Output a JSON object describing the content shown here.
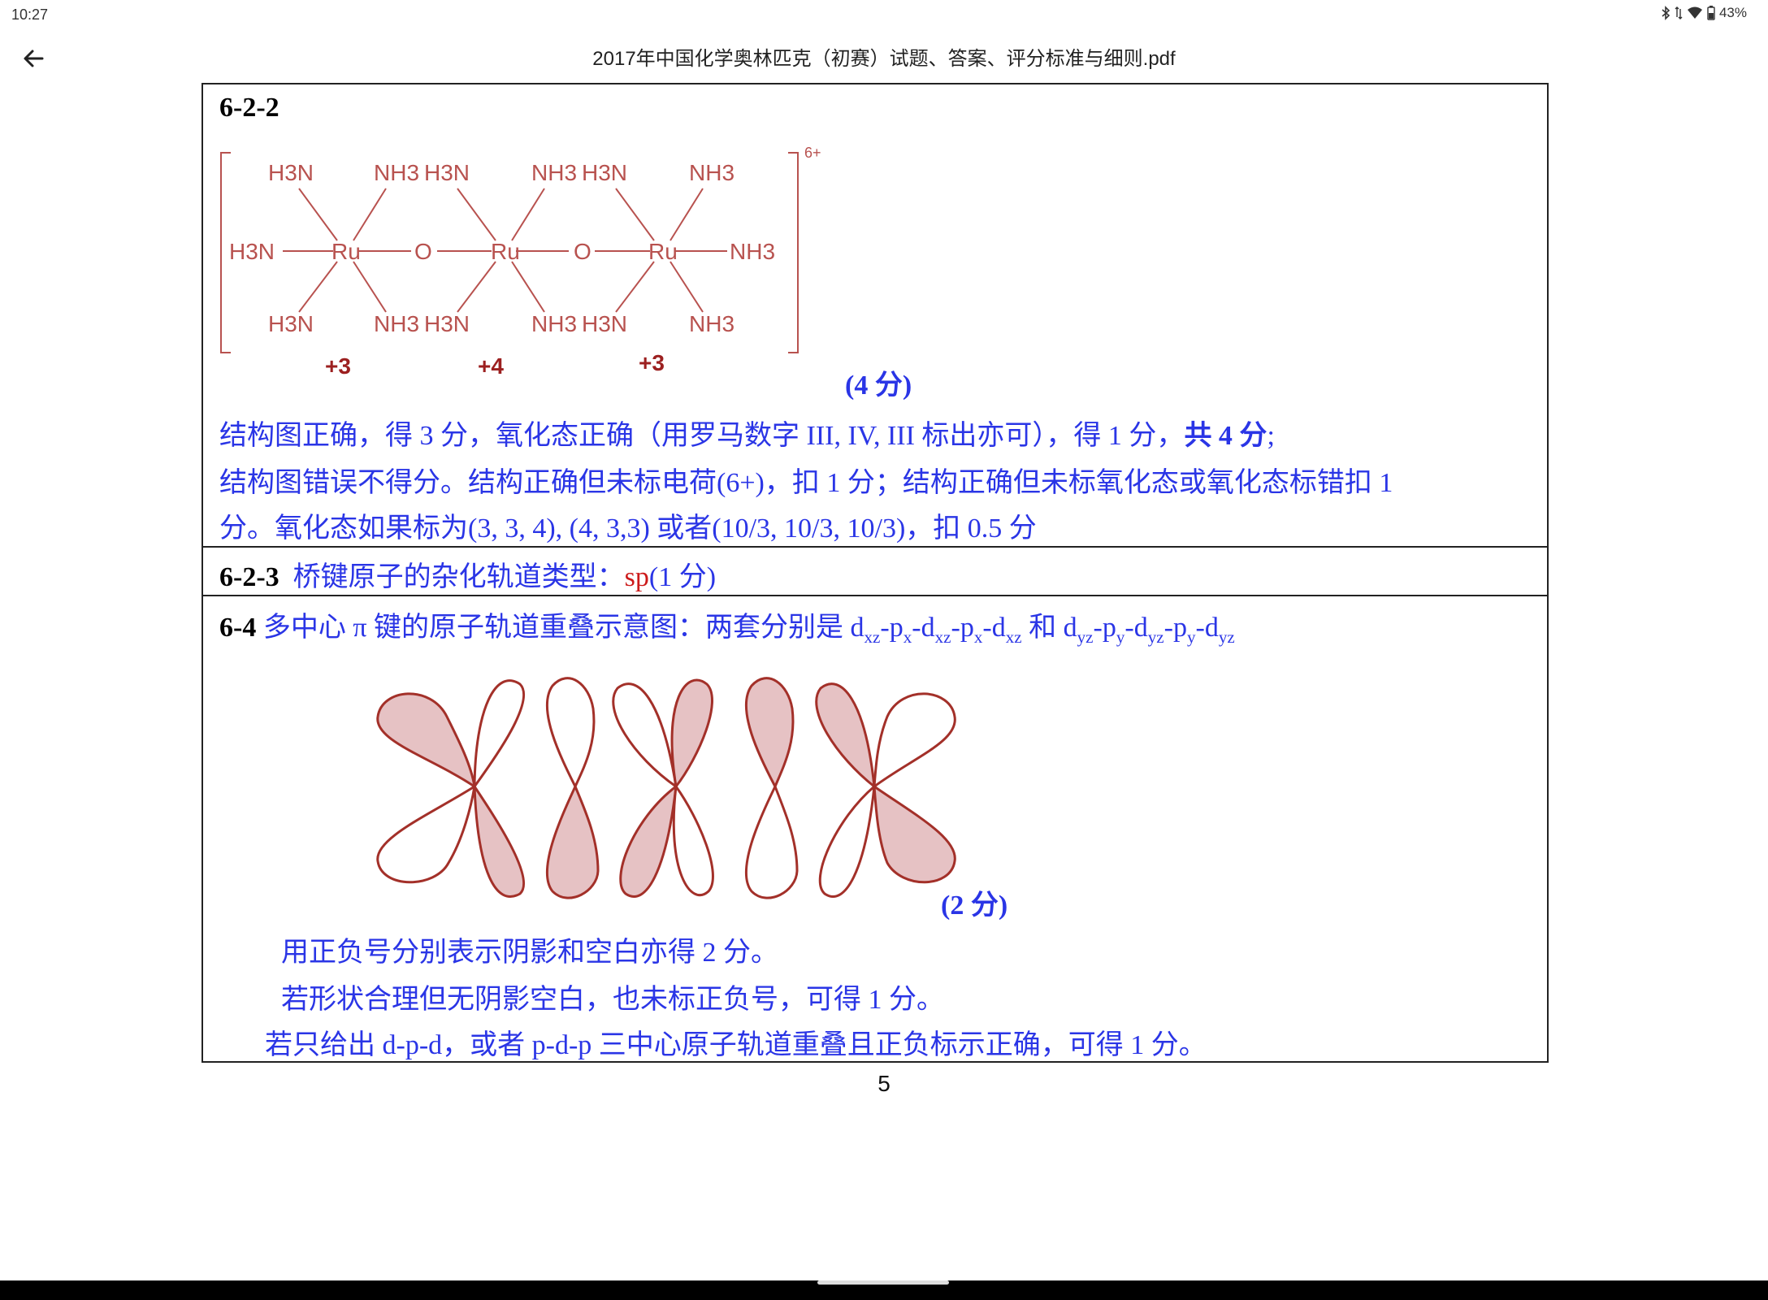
{
  "status": {
    "time": "10:27",
    "battery": "43%"
  },
  "appbar": {
    "title": "2017年中国化学奥林匹克（初赛）试题、答案、评分标准与细则.pdf"
  },
  "sections": {
    "s622": {
      "heading": "6-2-2",
      "formula": {
        "charge": "6+",
        "row_top": [
          "H3N",
          "NH3",
          "H3N",
          "NH3",
          "H3N",
          "NH3"
        ],
        "center_left": "H3N",
        "ru": "Ru",
        "o": "O",
        "center_right": "NH3",
        "row_bottom": [
          "H3N",
          "NH3",
          "H3N",
          "NH3",
          "H3N",
          "NH3"
        ],
        "oxidation_states": [
          "+3",
          "+4",
          "+3"
        ]
      },
      "score": "(4 分)",
      "line1_a": "结构图正确，得 3 分，氧化态正确（用罗马数字 III, IV, III 标出亦可），得 1 分，",
      "line1_b": "共 4 分",
      "line1_c": ";",
      "line2": "结构图错误不得分。结构正确但未标电荷(6+)，扣 1 分；结构正确但未标氧化态或氧化态标错扣 1",
      "line3": "分。氧化态如果标为(3, 3, 4), (4, 3,3) 或者(10/3, 10/3, 10/3)，扣 0.5 分"
    },
    "s623": {
      "heading": "6-2-3",
      "text": "桥键原子的杂化轨道类型：",
      "answer": "sp",
      "score": "(1 分)"
    },
    "s64": {
      "heading": "6-4",
      "text": "多中心 π 键的原子轨道重叠示意图：两套分别是",
      "set1": "dxz-px-dxz-px-dxz",
      "and": "和",
      "set2": "dyz-py-dyz-py-dyz",
      "score": "(2 分)",
      "note1": "用正负号分别表示阴影和空白亦得 2 分。",
      "note2": "若形状合理但无阴影空白，也未标正负号，可得 1 分。",
      "note3": "若只给出 d-p-d，或者 p-d-p 三中心原子轨道重叠且正负标示正确，可得 1 分。"
    }
  },
  "page_number": "5",
  "colors": {
    "answer_blue": "#2a35e6",
    "structure_red": "#b8524f",
    "orbital_stroke": "#a33029",
    "orbital_fill": "#e6c2c4"
  }
}
